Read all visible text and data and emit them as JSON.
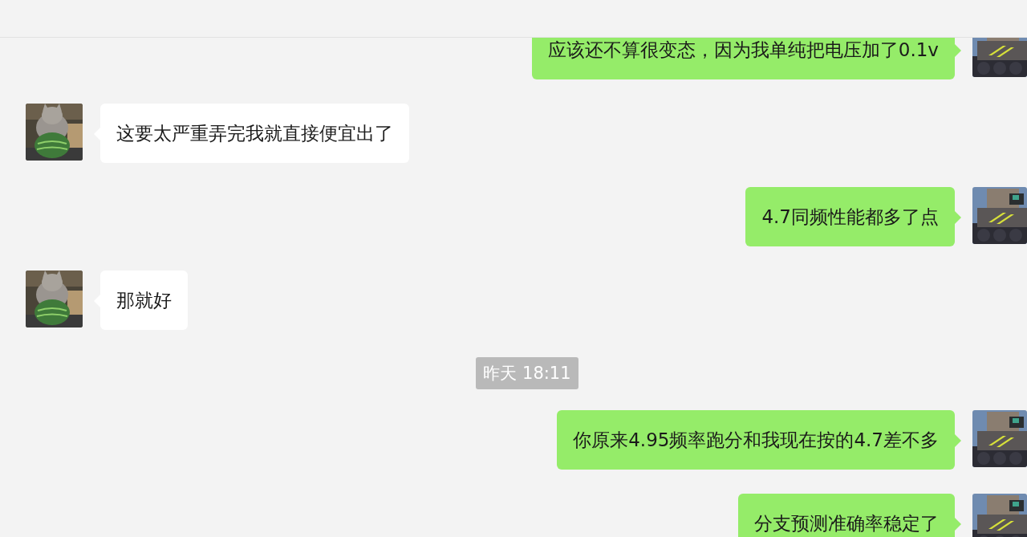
{
  "messages": [
    {
      "kind": "sent",
      "text": "应该还不算很变态，因为我单纯把电压加了0.1v"
    },
    {
      "kind": "received",
      "text": "这要太严重弄完我就直接便宜出了"
    },
    {
      "kind": "sent",
      "text": "4.7同频性能都多了点"
    },
    {
      "kind": "received",
      "text": "那就好"
    },
    {
      "kind": "time",
      "text": "昨天 18:11"
    },
    {
      "kind": "sent",
      "text": "你原来4.95频率跑分和我现在按的4.7差不多"
    },
    {
      "kind": "sent",
      "text": "分支预测准确率稳定了"
    }
  ]
}
